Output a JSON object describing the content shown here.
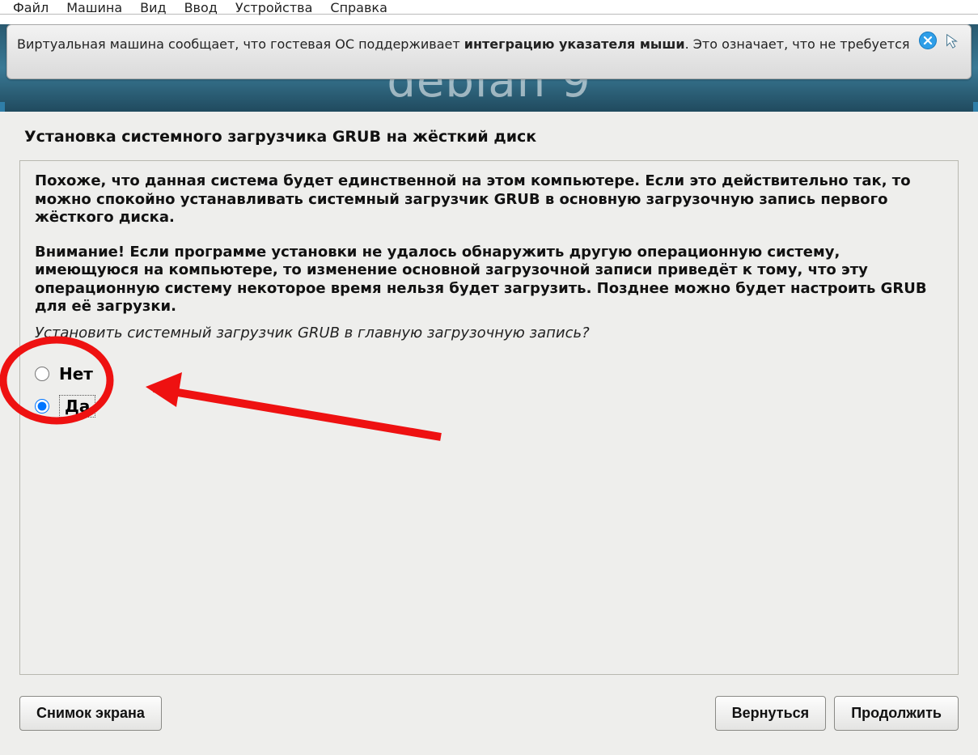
{
  "menu": {
    "file": "Файл",
    "machine": "Машина",
    "view": "Вид",
    "input": "Ввод",
    "devices": "Устройства",
    "help": "Справка"
  },
  "notice": {
    "text_before": "Виртуальная машина сообщает, что гостевая ОС поддерживает ",
    "text_bold": "интеграцию указателя мыши",
    "text_after": ". Это означает, что не требуется"
  },
  "branding": {
    "logo_text": "debian 9"
  },
  "installer": {
    "title": "Установка системного загрузчика GRUB на жёсткий диск",
    "para1": "Похоже, что данная система будет единственной на этом компьютере. Если это действительно так, то можно спокойно устанавливать системный загрузчик GRUB в основную загрузочную запись первого жёсткого диска.",
    "para2": "Внимание! Если программе установки не удалось обнаружить другую операционную систему, имеющуюся на компьютере, то изменение основной загрузочной записи приведёт к тому, что эту операционную систему некоторое время нельзя будет загрузить. Позднее можно будет настроить GRUB для её загрузки.",
    "question": "Установить системный загрузчик GRUB в главную загрузочную запись?",
    "radio_no": "Нет",
    "radio_yes": "Да",
    "selected": "yes"
  },
  "buttons": {
    "screenshot": "Снимок экрана",
    "back": "Вернуться",
    "continue": "Продолжить"
  }
}
